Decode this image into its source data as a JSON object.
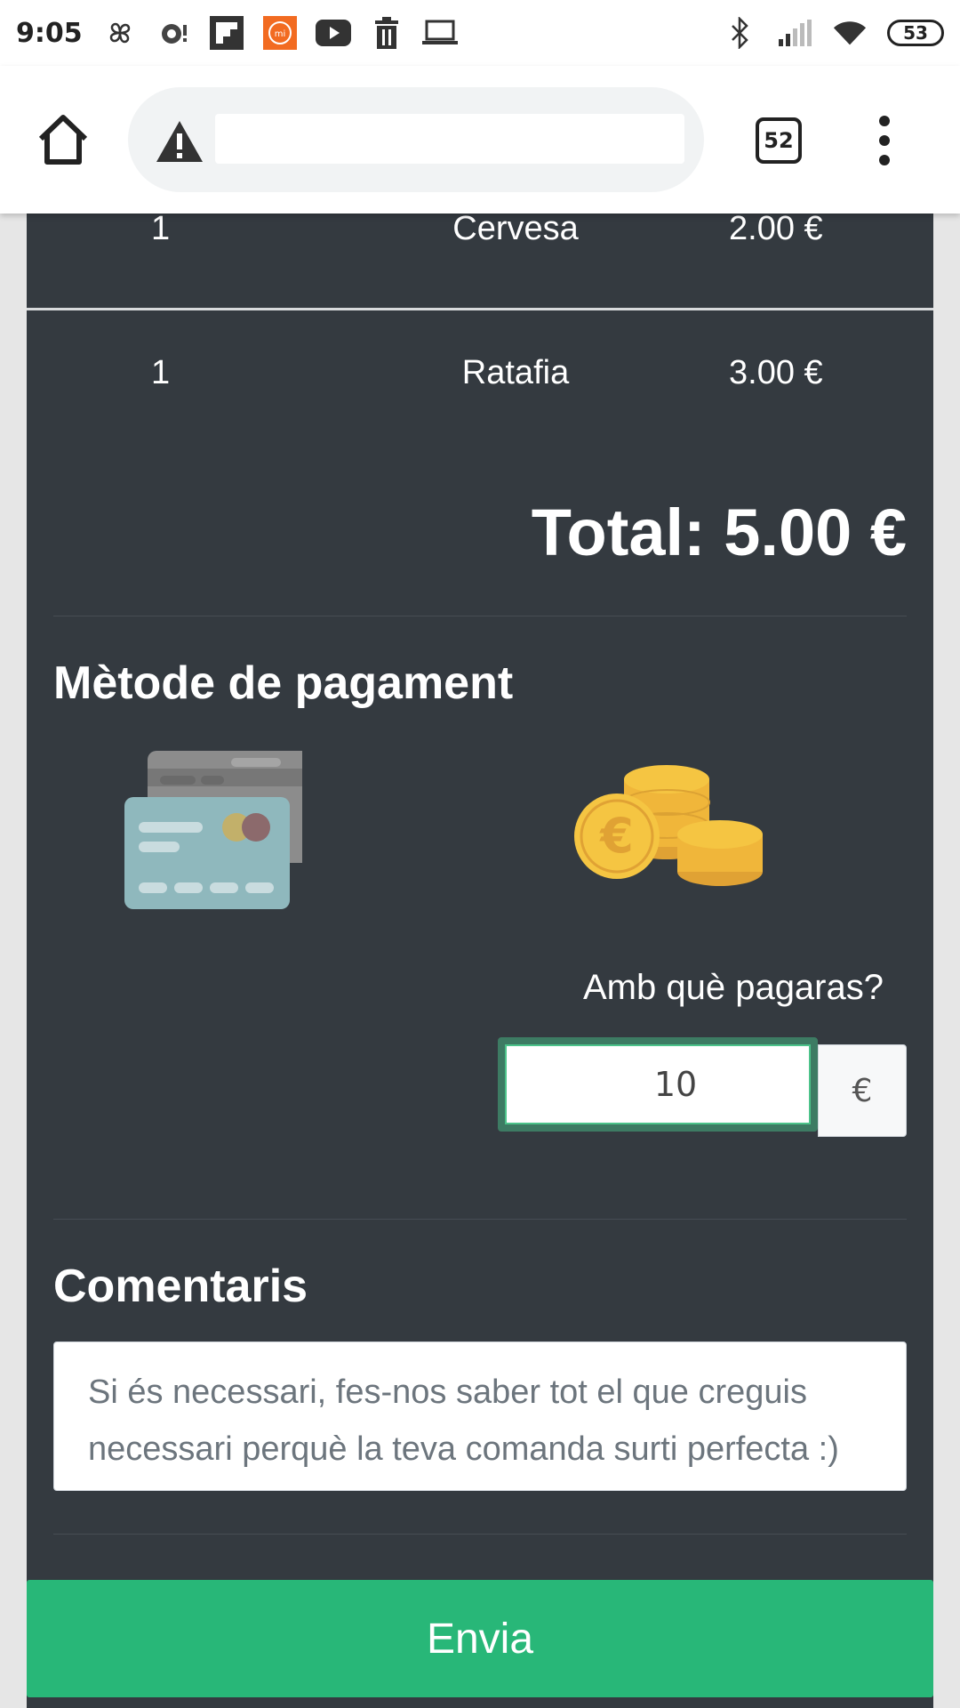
{
  "status_bar": {
    "time": "9:05",
    "battery": "53",
    "left_icons": [
      "pinwheel-icon",
      "camera-notification-icon",
      "flipboard-icon",
      "mi-icon",
      "youtube-icon",
      "trash-icon",
      "laptop-icon"
    ],
    "right_icons": [
      "bluetooth-icon",
      "signal-icon",
      "wifi-icon"
    ]
  },
  "browser": {
    "url": "",
    "tab_count": "52"
  },
  "order": {
    "items": [
      {
        "qty": "1",
        "name": "Cervesa",
        "price": "2.00 €"
      },
      {
        "qty": "1",
        "name": "Ratafia",
        "price": "3.00 €"
      }
    ],
    "total": "Total: 5.00 €"
  },
  "payment": {
    "title": "Mètode de pagament",
    "cash_label": "Amb què pagaras?",
    "cash_value": "10",
    "currency_addon": "€"
  },
  "comments": {
    "title": "Comentaris",
    "placeholder": "Si és necessari, fes-nos saber tot el que creguis necessari perquè la teva comanda surti perfecta :)"
  },
  "actions": {
    "submit_label": "Envia"
  },
  "colors": {
    "panel_bg": "#343a40",
    "submit_bg": "#28b778",
    "input_focus": "#3d7b63",
    "coin": "#f5c542",
    "card": "#8fb8bd"
  }
}
